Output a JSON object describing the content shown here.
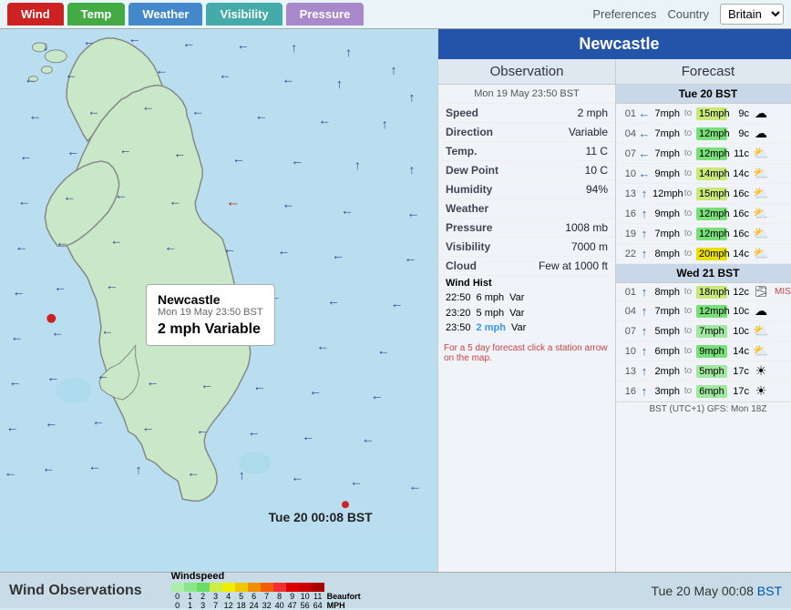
{
  "header": {
    "tabs": [
      {
        "label": "Wind",
        "key": "wind",
        "style": "active-wind"
      },
      {
        "label": "Temp",
        "key": "temp",
        "style": "active-temp"
      },
      {
        "label": "Weather",
        "key": "weather",
        "style": "weather"
      },
      {
        "label": "Visibility",
        "key": "visibility",
        "style": "visibility"
      },
      {
        "label": "Pressure",
        "key": "pressure",
        "style": "pressure"
      }
    ],
    "preferences_label": "Preferences",
    "country_label": "Country",
    "country_selected": "Britain"
  },
  "city": "Newcastle",
  "observation": {
    "header": "Observation",
    "date": "Mon 19 May 23:50 BST",
    "rows": [
      {
        "label": "Speed",
        "value": "2 mph"
      },
      {
        "label": "Direction",
        "value": "Variable"
      },
      {
        "label": "Temp.",
        "value": "11 C"
      },
      {
        "label": "Dew Point",
        "value": "10 C"
      },
      {
        "label": "Humidity",
        "value": "94%"
      },
      {
        "label": "Weather",
        "value": ""
      },
      {
        "label": "Pressure",
        "value": "1008 mb"
      },
      {
        "label": "Visibility",
        "value": "7000 m"
      },
      {
        "label": "Cloud",
        "value": "Few at 1000 ft"
      }
    ],
    "wind_hist_label": "Wind Hist",
    "wind_hist": [
      {
        "time": "22:50",
        "speed": "6 mph",
        "dir": "Var"
      },
      {
        "time": "23:20",
        "speed": "5 mph",
        "dir": "Var"
      },
      {
        "time": "23:50",
        "speed": "2 mph",
        "dir": "Var",
        "highlight": true
      }
    ]
  },
  "forecast": {
    "header": "Forecast",
    "days": [
      {
        "day": "Tue 20 BST",
        "rows": [
          {
            "hour": "01",
            "arrow": "←",
            "from": "7mph",
            "to": "15mph",
            "to_class": "ws-3",
            "temp": "9c",
            "icon": "cloud"
          },
          {
            "hour": "04",
            "arrow": "←",
            "from": "7mph",
            "to": "12mph",
            "to_class": "ws-2",
            "temp": "9c",
            "icon": "cloud"
          },
          {
            "hour": "07",
            "arrow": "←",
            "from": "7mph",
            "to": "12mph",
            "to_class": "ws-2",
            "temp": "11c",
            "icon": "pcloud"
          },
          {
            "hour": "10",
            "arrow": "←",
            "from": "9mph",
            "to": "14mph",
            "to_class": "ws-3",
            "temp": "14c",
            "icon": "pcloud"
          },
          {
            "hour": "13",
            "arrow": "↑",
            "from": "12mph",
            "to": "15mph",
            "to_class": "ws-3",
            "temp": "16c",
            "icon": "pcloud"
          },
          {
            "hour": "16",
            "arrow": "↑",
            "from": "9mph",
            "to": "12mph",
            "to_class": "ws-2",
            "temp": "16c",
            "icon": "pcloud"
          },
          {
            "hour": "19",
            "arrow": "↑",
            "from": "7mph",
            "to": "12mph",
            "to_class": "ws-2",
            "temp": "16c",
            "icon": "pcloud"
          },
          {
            "hour": "22",
            "arrow": "↑",
            "from": "8mph",
            "to": "20mph",
            "to_class": "ws-4",
            "temp": "14c",
            "icon": "pcloud"
          }
        ]
      },
      {
        "day": "Wed 21 BST",
        "rows": [
          {
            "hour": "01",
            "arrow": "↑",
            "from": "8mph",
            "to": "18mph",
            "to_class": "ws-3",
            "temp": "12c",
            "icon": "mist",
            "extra": "MIST"
          },
          {
            "hour": "04",
            "arrow": "↑",
            "from": "7mph",
            "to": "12mph",
            "to_class": "ws-2",
            "temp": "10c",
            "icon": "cloud"
          },
          {
            "hour": "07",
            "arrow": "↑",
            "from": "5mph",
            "to": "7mph",
            "to_class": "ws-1",
            "temp": "10c",
            "icon": "pcloud"
          },
          {
            "hour": "10",
            "arrow": "↑",
            "from": "6mph",
            "to": "9mph",
            "to_class": "ws-2",
            "temp": "14c",
            "icon": "pcloud"
          },
          {
            "hour": "13",
            "arrow": "↑",
            "from": "2mph",
            "to": "5mph",
            "to_class": "ws-1",
            "temp": "17c",
            "icon": "sun"
          },
          {
            "hour": "16",
            "arrow": "↑",
            "from": "3mph",
            "to": "6mph",
            "to_class": "ws-1",
            "temp": "17c",
            "icon": "sun"
          }
        ]
      }
    ],
    "bst_note": "BST (UTC+1) GFS: Mon 18Z",
    "fc_note": "For a 5 day forecast click a station arrow on the map."
  },
  "bottom": {
    "title": "Wind Observations",
    "time": "Tue 20 May 00:08",
    "time_suffix": "BST"
  },
  "map_time": "Tue 20 00:08 BST",
  "tooltip": {
    "city": "Newcastle",
    "date": "Mon 19 May 23:50 BST",
    "wind": "2 mph Variable"
  },
  "legend": {
    "title": "Windspeed",
    "beaufort": "Beaufort",
    "mph": "MPH",
    "segments": [
      {
        "color": "#aaf0aa",
        "label": "0"
      },
      {
        "color": "#88e888",
        "label": "1"
      },
      {
        "color": "#66dd66",
        "label": "2"
      },
      {
        "color": "#ccee44",
        "label": "3"
      },
      {
        "color": "#eeee00",
        "label": "4"
      },
      {
        "color": "#f0c800",
        "label": "5"
      },
      {
        "color": "#f09000",
        "label": "6"
      },
      {
        "color": "#f06000",
        "label": "7"
      },
      {
        "color": "#f03030",
        "label": "8"
      },
      {
        "color": "#dd0000",
        "label": "9"
      },
      {
        "color": "#cc0000",
        "label": "10"
      },
      {
        "color": "#aa0000",
        "label": "11"
      }
    ],
    "mph_values": [
      "0",
      "1",
      "3",
      "7",
      "12",
      "18",
      "24",
      "32",
      "40",
      "47",
      "56",
      "64"
    ]
  }
}
